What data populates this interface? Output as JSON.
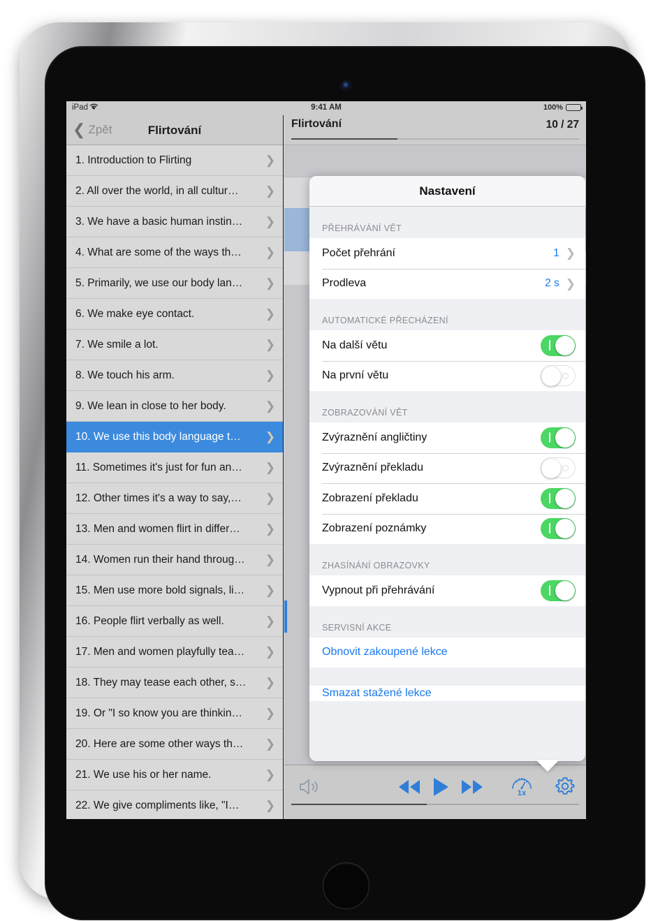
{
  "status_bar": {
    "device": "iPad",
    "wifi_icon": "wifi-icon",
    "time": "9:41 AM",
    "battery_percent": "100%",
    "battery_level": 100
  },
  "sidebar": {
    "back_label": "Zpět",
    "title": "Flirtování",
    "items": [
      {
        "label": "1. Introduction to Flirting",
        "selected": false
      },
      {
        "label": "2. All over the world, in all cultur…",
        "selected": false
      },
      {
        "label": "3. We have a basic human instin…",
        "selected": false
      },
      {
        "label": "4. What are some of the ways th…",
        "selected": false
      },
      {
        "label": "5. Primarily, we use our body lan…",
        "selected": false
      },
      {
        "label": "6. We make eye contact.",
        "selected": false
      },
      {
        "label": "7. We smile a lot.",
        "selected": false
      },
      {
        "label": "8. We touch his arm.",
        "selected": false
      },
      {
        "label": "9. We lean in close to her body.",
        "selected": false
      },
      {
        "label": "10. We use this body language t…",
        "selected": true
      },
      {
        "label": "11. Sometimes it's just for fun an…",
        "selected": false
      },
      {
        "label": "12. Other times it's a way to say,…",
        "selected": false
      },
      {
        "label": "13. Men and women flirt in differ…",
        "selected": false
      },
      {
        "label": "14. Women run their hand throug…",
        "selected": false
      },
      {
        "label": "15. Men use more bold signals, li…",
        "selected": false
      },
      {
        "label": "16. People flirt verbally as well.",
        "selected": false
      },
      {
        "label": "17. Men and women playfully tea…",
        "selected": false
      },
      {
        "label": "18. They may tease each other, s…",
        "selected": false
      },
      {
        "label": "19. Or \"I so know you are thinkin…",
        "selected": false
      },
      {
        "label": "20. Here are some other ways th…",
        "selected": false
      },
      {
        "label": "21. We use his or her name.",
        "selected": false
      },
      {
        "label": "22. We give compliments like, \"I…",
        "selected": false
      }
    ]
  },
  "detail": {
    "title": "Flirtování",
    "counter": "10 / 27",
    "progress_percent": 37
  },
  "toolbar": {
    "speaker_icon": "speaker-icon",
    "rewind_icon": "rewind-icon",
    "play_icon": "play-icon",
    "forward_icon": "fast-forward-icon",
    "speed_icon": "speed-gauge-icon",
    "speed_label": "1x",
    "gear_icon": "gear-icon",
    "seek_percent": 47
  },
  "popover": {
    "title": "Nastavení",
    "sections": [
      {
        "header": "PŘEHRÁVÁNÍ VĚT",
        "rows": [
          {
            "label": "Počet přehrání",
            "value": "1",
            "type": "disclosure"
          },
          {
            "label": "Prodleva",
            "value": "2 s",
            "type": "disclosure"
          }
        ]
      },
      {
        "header": "AUTOMATICKÉ PŘECHÁZENÍ",
        "rows": [
          {
            "label": "Na další větu",
            "type": "switch",
            "on": true
          },
          {
            "label": "Na první větu",
            "type": "switch",
            "on": false
          }
        ]
      },
      {
        "header": "ZOBRAZOVÁNÍ VĚT",
        "rows": [
          {
            "label": "Zvýraznění angličtiny",
            "type": "switch",
            "on": true
          },
          {
            "label": "Zvýraznění překladu",
            "type": "switch",
            "on": false
          },
          {
            "label": "Zobrazení překladu",
            "type": "switch",
            "on": true
          },
          {
            "label": "Zobrazení poznámky",
            "type": "switch",
            "on": true
          }
        ]
      },
      {
        "header": "ZHASÍNÁNÍ OBRAZOVKY",
        "rows": [
          {
            "label": "Vypnout při přehrávání",
            "type": "switch",
            "on": true
          }
        ]
      },
      {
        "header": "SERVISNÍ AKCE",
        "rows": [
          {
            "label": "Obnovit zakoupené lekce",
            "type": "link"
          }
        ]
      },
      {
        "header": "",
        "rows": [
          {
            "label": "Smazat stažené lekce",
            "type": "link",
            "clipped": true
          }
        ]
      }
    ]
  },
  "colors": {
    "accent_blue": "#1879ec",
    "toolbar_blue": "#2f7ed8",
    "switch_green": "#4bd763",
    "selection_blue": "#3b8ade"
  }
}
